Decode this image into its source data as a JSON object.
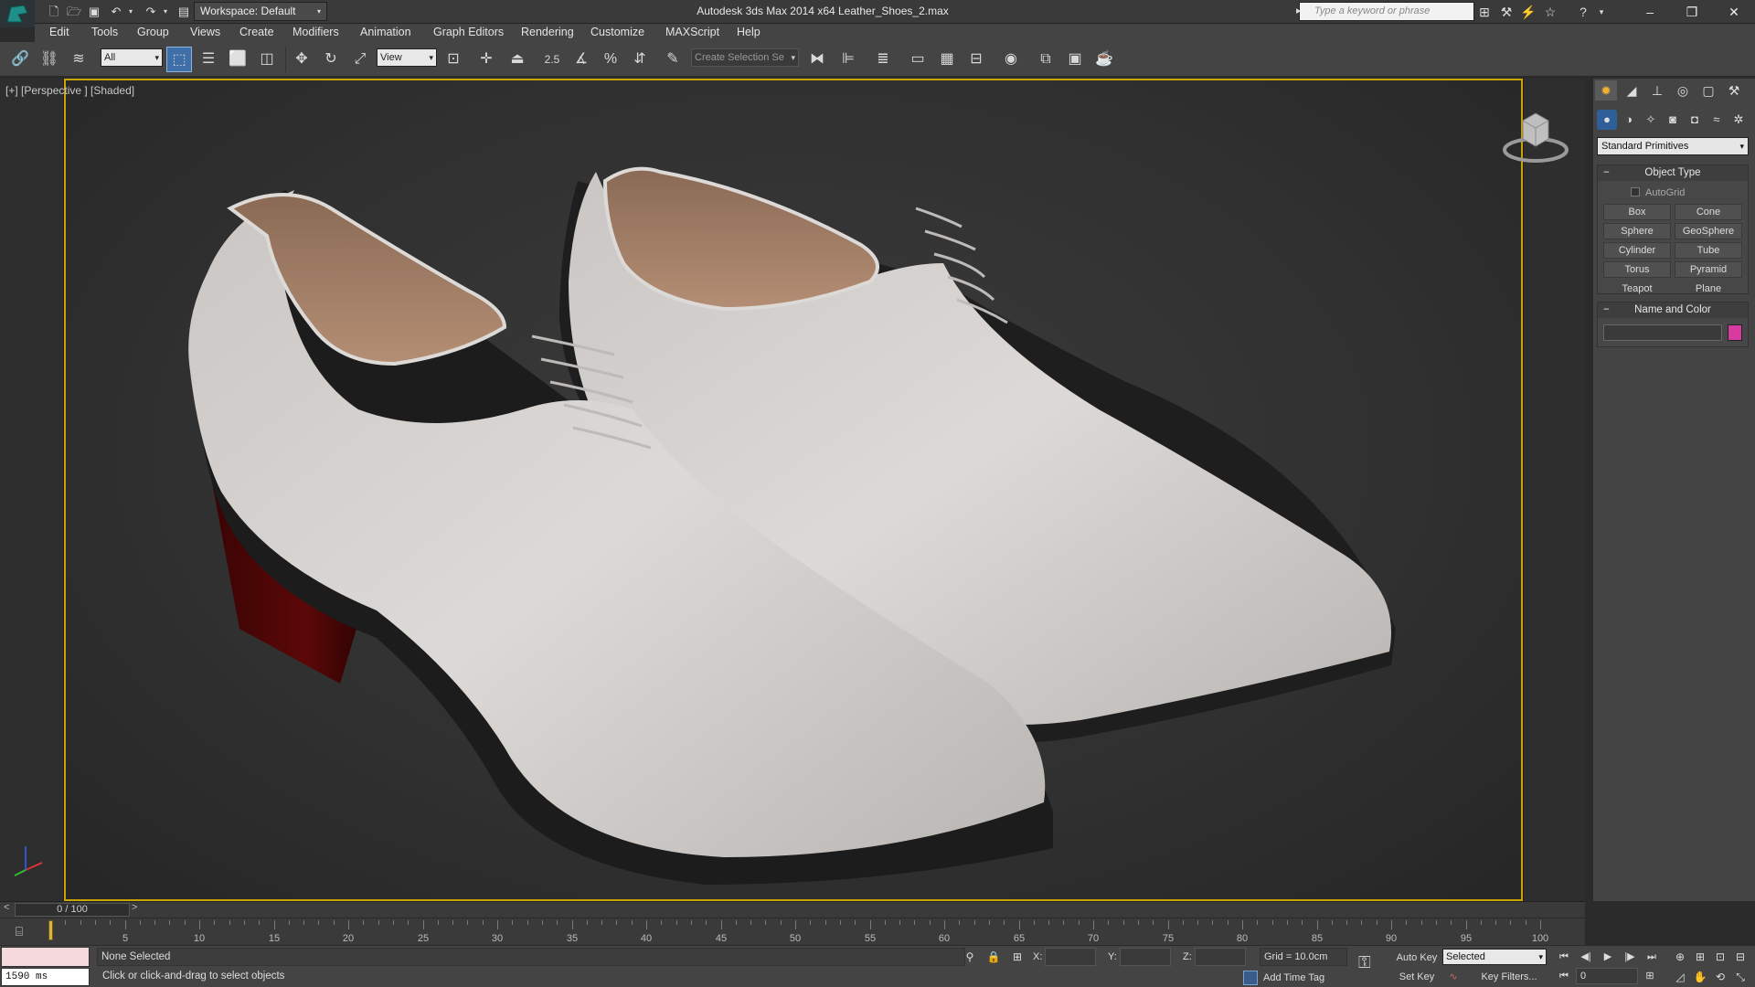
{
  "titlebar": {
    "workspace_label": "Workspace: Default",
    "window_title": "Autodesk 3ds Max  2014 x64      Leather_Shoes_2.max",
    "search_placeholder": "Type a keyword or phrase",
    "minimize": "–",
    "restore": "❐",
    "close": "✕"
  },
  "menu": [
    "Edit",
    "Tools",
    "Group",
    "Views",
    "Create",
    "Modifiers",
    "Animation",
    "Graph Editors",
    "Rendering",
    "Customize",
    "MAXScript",
    "Help"
  ],
  "toolbar": {
    "selection_filter": "All",
    "reference_coord": "View",
    "snap_label": "2.5",
    "named_selection_placeholder": "Create Selection Se"
  },
  "viewport": {
    "label": "[+] [Perspective ] [Shaded]"
  },
  "command_panel": {
    "category": "Standard Primitives",
    "object_type_title": "Object Type",
    "autogrid_label": "AutoGrid",
    "primitives": [
      "Box",
      "Cone",
      "Sphere",
      "GeoSphere",
      "Cylinder",
      "Tube",
      "Torus",
      "Pyramid",
      "Teapot",
      "Plane"
    ],
    "name_color_title": "Name and Color",
    "object_color": "#d83aa0"
  },
  "timeslider": {
    "position": "0 / 100",
    "ticks": [
      "5",
      "10",
      "15",
      "20",
      "25",
      "30",
      "35",
      "40",
      "45",
      "50",
      "55",
      "60",
      "65",
      "70",
      "75",
      "80",
      "85",
      "90",
      "95",
      "100"
    ]
  },
  "status": {
    "ms_readout": "1590 ms",
    "selection": "None Selected",
    "prompt": "Click or click-and-drag to select objects",
    "x_label": "X:",
    "y_label": "Y:",
    "z_label": "Z:",
    "grid": "Grid = 10.0cm",
    "add_time_tag": "Add Time Tag",
    "auto_key": "Auto Key",
    "set_key": "Set Key",
    "key_mode": "Selected",
    "key_filters": "Key Filters...",
    "current_frame": "0"
  }
}
